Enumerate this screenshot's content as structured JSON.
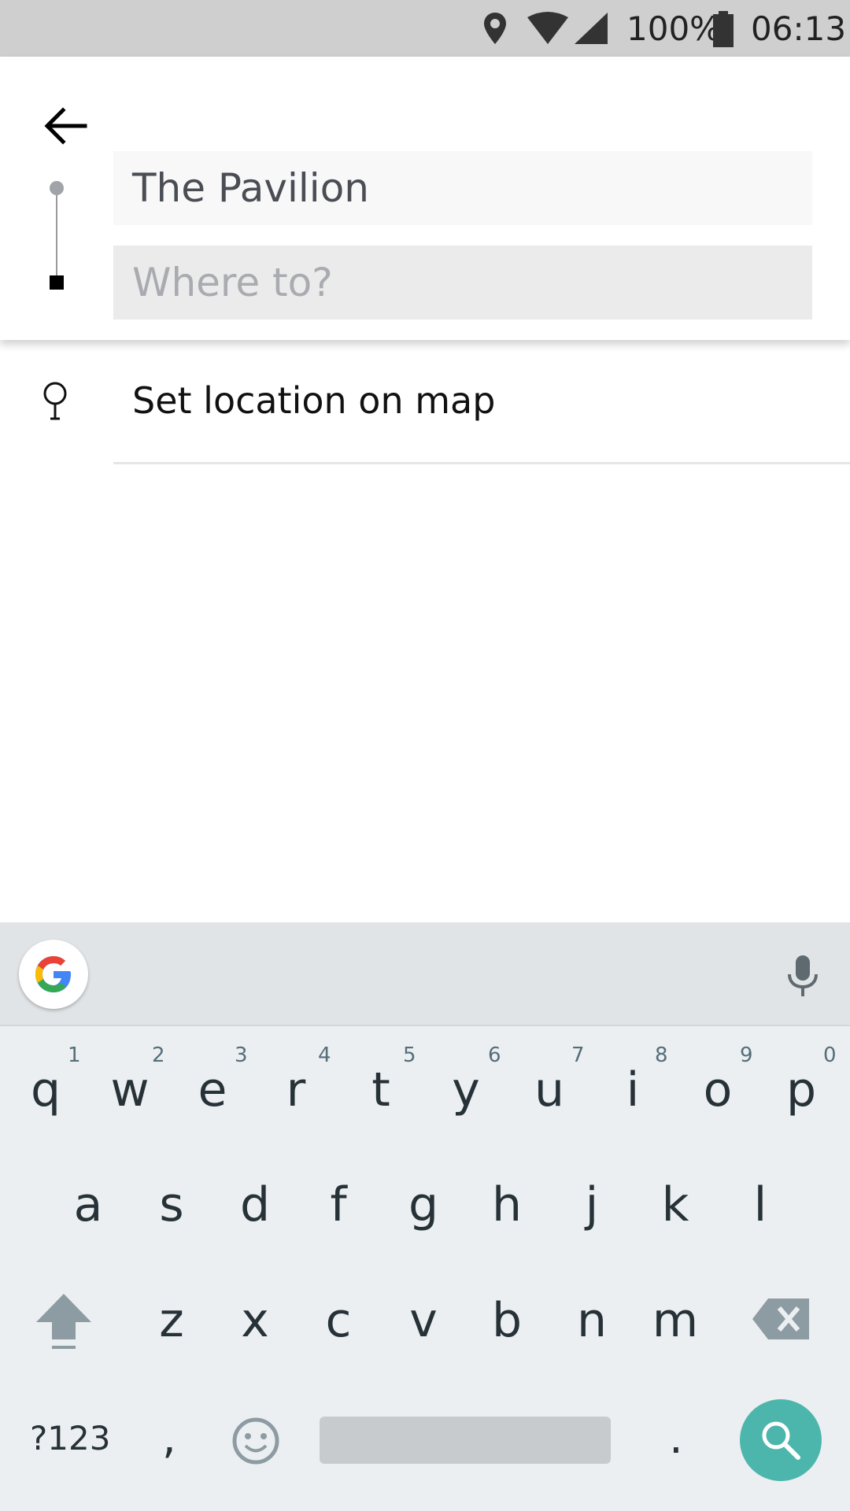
{
  "status_bar": {
    "battery_text": "100%",
    "clock": "06:13",
    "icons": [
      "location-pin-icon",
      "wifi-icon",
      "signal-icon",
      "battery-icon"
    ]
  },
  "search": {
    "back_icon": "arrow-left-icon",
    "pickup_value": "The Pavilion",
    "destination_placeholder": "Where to?",
    "destination_value": ""
  },
  "suggestions": [
    {
      "icon": "map-pin-icon",
      "label": "Set location on map"
    }
  ],
  "keyboard": {
    "accent_color": "#4db6ac",
    "row1": [
      {
        "key": "q",
        "hint": "1"
      },
      {
        "key": "w",
        "hint": "2"
      },
      {
        "key": "e",
        "hint": "3"
      },
      {
        "key": "r",
        "hint": "4"
      },
      {
        "key": "t",
        "hint": "5"
      },
      {
        "key": "y",
        "hint": "6"
      },
      {
        "key": "u",
        "hint": "7"
      },
      {
        "key": "i",
        "hint": "8"
      },
      {
        "key": "o",
        "hint": "9"
      },
      {
        "key": "p",
        "hint": "0"
      }
    ],
    "row2": [
      "a",
      "s",
      "d",
      "f",
      "g",
      "h",
      "j",
      "k",
      "l"
    ],
    "row3": [
      "z",
      "x",
      "c",
      "v",
      "b",
      "n",
      "m"
    ],
    "symbols_label": "?123",
    "comma": ",",
    "period": "."
  }
}
